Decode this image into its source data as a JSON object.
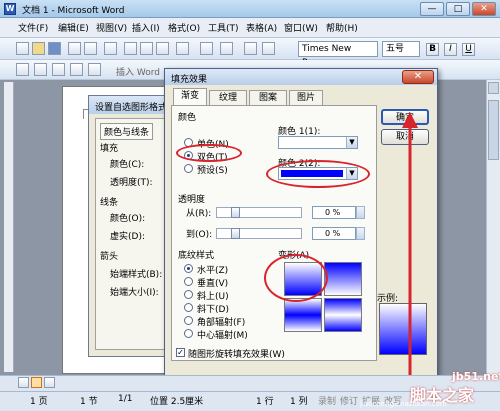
{
  "window": {
    "title": "文档 1 - Microsoft Word",
    "minimize": "—",
    "maximize": "□",
    "close": "✕"
  },
  "menu": [
    "文件(F)",
    "编辑(E)",
    "视图(V)",
    "插入(I)",
    "格式(O)",
    "工具(T)",
    "表格(A)",
    "窗口(W)",
    "帮助(H)"
  ],
  "toolbar": {
    "font": "Times New Roman",
    "size": "五号",
    "insert_word": "插入 Word"
  },
  "bg_dialog": {
    "title": "设置自选图形格式",
    "tab": "颜色与线条",
    "fill_label": "填充",
    "color_label": "颜色(C):",
    "transparency_label": "透明度(T):",
    "line_label": "线条",
    "line_color_label": "颜色(O):",
    "dashed_label": "虚实(D):",
    "arrows_label": "箭头",
    "begin_style_label": "始端样式(B):",
    "begin_size_label": "始端大小(I):"
  },
  "dialog": {
    "title": "填充效果",
    "tabs": [
      "渐变",
      "纹理",
      "图案",
      "图片"
    ],
    "active_tab": "渐变",
    "colors_group": "颜色",
    "color_options": [
      {
        "label": "单色(N)",
        "selected": false
      },
      {
        "label": "双色(T)",
        "selected": true
      },
      {
        "label": "预设(S)",
        "selected": false
      }
    ],
    "color1_label": "颜色 1(1):",
    "color2_label": "颜色 2(2):",
    "color2_value": "#0000ff",
    "transparency_group": "透明度",
    "from_label": "从(R):",
    "to_label": "到(O):",
    "from_value": "0 %",
    "to_value": "0 %",
    "shading_group": "底纹样式",
    "shading_options": [
      {
        "label": "水平(Z)",
        "selected": true
      },
      {
        "label": "垂直(V)",
        "selected": false
      },
      {
        "label": "斜上(U)",
        "selected": false
      },
      {
        "label": "斜下(D)",
        "selected": false
      },
      {
        "label": "角部辐射(F)",
        "selected": false
      },
      {
        "label": "中心辐射(M)",
        "selected": false
      }
    ],
    "variants_label": "变形(A)",
    "sample_label": "示例:",
    "rotate_label": "随图形旋转填充效果(W)",
    "rotate_checked": true,
    "ok": "确定",
    "cancel": "取消"
  },
  "status": {
    "page": "1 页",
    "section": "1 节",
    "page_of": "1/1",
    "position": "位置 2.5厘米",
    "line": "1 行",
    "col": "1 列",
    "rec": "录制",
    "trk": "修订",
    "ext": "扩展",
    "ovr": "改写"
  },
  "watermark": {
    "site": "jb51.net",
    "text": "脚本之家",
    "sub": "jiaocheng.chazidian.com"
  }
}
